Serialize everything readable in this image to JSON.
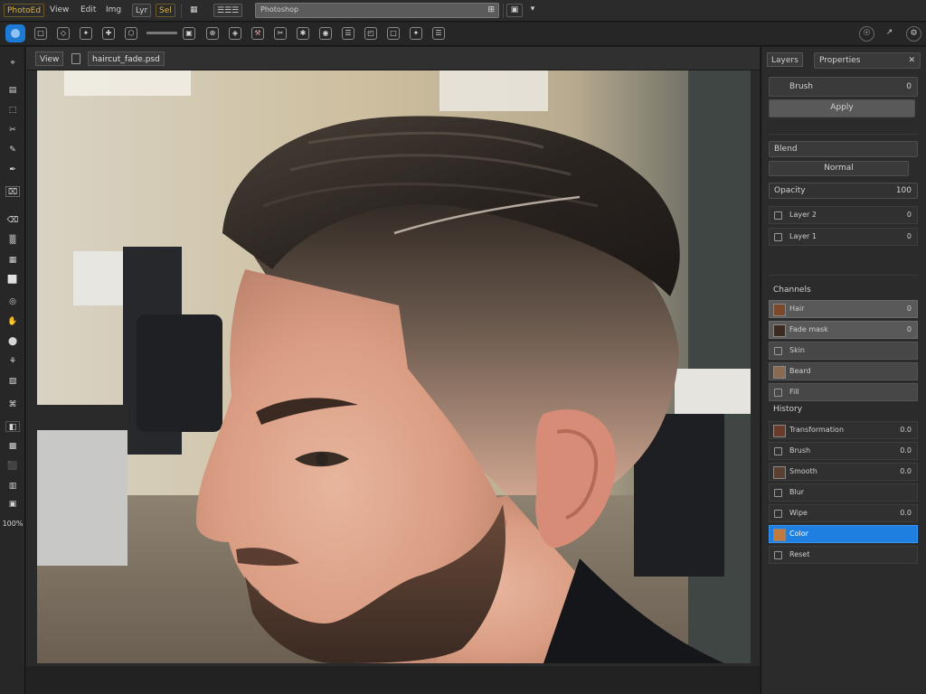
{
  "menu": {
    "logo": "PhotoEd",
    "items": [
      "View",
      "Edit",
      "Img",
      "Lyr",
      "Sel"
    ],
    "field": "Photoshop",
    "field_icon": "⊞",
    "extra_icon": "▣",
    "extra_arrow": "▾"
  },
  "options": {
    "icons": [
      "□",
      "◇",
      "✦",
      "✚",
      "⬡",
      "▣",
      "⊕",
      "◈",
      "⚒",
      "✂",
      "✱",
      "◉",
      "☰",
      "◰"
    ],
    "right_icons": [
      "☉",
      "↗",
      "⚙"
    ]
  },
  "tools": [
    "⌖",
    "▤",
    "⬚",
    "✂",
    "✎",
    "✒",
    "⌧",
    "⌫",
    "▒",
    "▦",
    "⬜",
    "◎",
    "✋",
    "⬤",
    "⚘",
    "▧",
    "⌘",
    "◧",
    "▩",
    "⬛",
    "▥",
    "▣",
    "◼"
  ],
  "tool_bottom": "100%",
  "document": {
    "tab": "View",
    "name": "haircut_fade.psd"
  },
  "panel": {
    "tab1": "Layers",
    "tab2": "Properties",
    "brush_label": "Brush",
    "brush_value": "0",
    "action": "Apply",
    "mode_label": "Blend",
    "mode_value": "Normal",
    "opacity_label": "Opacity",
    "opacity_value": "100",
    "small_rows": [
      {
        "label": "Layer 2",
        "value": "0"
      },
      {
        "label": "Layer 1",
        "value": "0"
      }
    ],
    "layers_header": "Channels",
    "layers": [
      {
        "label": "Hair",
        "value": "0",
        "style": "light",
        "thumb": "#7a4a2a"
      },
      {
        "label": "Fade mask",
        "value": "0",
        "style": "light",
        "thumb": "#3a2a20"
      },
      {
        "label": "Skin",
        "value": "",
        "style": "mid",
        "thumb": ""
      },
      {
        "label": "Beard",
        "value": "",
        "style": "mid",
        "thumb": "#8a6a50"
      },
      {
        "label": "Fill",
        "value": "",
        "style": "mid",
        "thumb": ""
      }
    ],
    "history_header": "History",
    "history": [
      {
        "label": "Transformation",
        "value": "0.0",
        "style": "",
        "thumb": "#6a3a2a"
      },
      {
        "label": "Brush",
        "value": "0.0",
        "style": "",
        "thumb": ""
      },
      {
        "label": "Smooth",
        "value": "0.0",
        "style": "",
        "thumb": "#5a4030"
      },
      {
        "label": "Blur",
        "value": "",
        "style": "",
        "thumb": ""
      },
      {
        "label": "Wipe",
        "value": "0.0",
        "style": "",
        "thumb": ""
      },
      {
        "label": "Color",
        "value": "",
        "style": "selected",
        "thumb": "#c07a40"
      },
      {
        "label": "Reset",
        "value": "",
        "style": "",
        "thumb": ""
      }
    ]
  }
}
